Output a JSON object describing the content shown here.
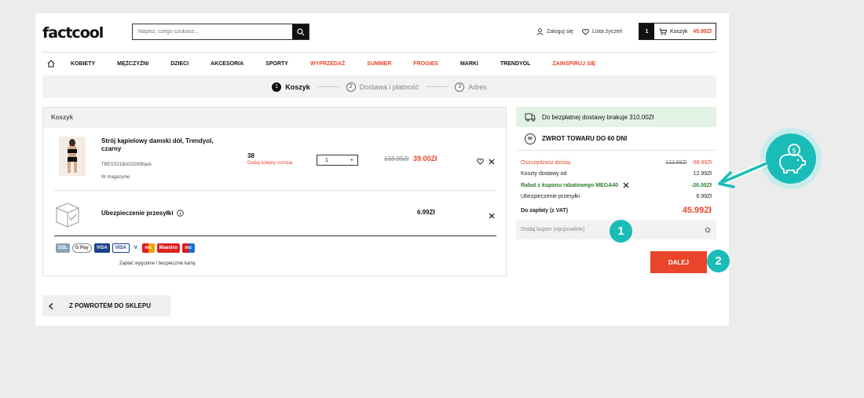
{
  "header": {
    "logo": "factcool",
    "search_placeholder": "Napisz, czego szukasz...",
    "login": "Zaloguj się",
    "wishlist": "Lista życzeń",
    "cart_count": "1",
    "cart_label": "Koszyk",
    "cart_total": "45.99Zł"
  },
  "nav": {
    "items": [
      {
        "label": "KOBIETY",
        "red": false
      },
      {
        "label": "MĘŻCZYŹNI",
        "red": false
      },
      {
        "label": "DZIECI",
        "red": false
      },
      {
        "label": "AKCESORIA",
        "red": false
      },
      {
        "label": "SPORTY",
        "red": false
      },
      {
        "label": "WYPRZEDAŻ",
        "red": true
      },
      {
        "label": "SUMMER",
        "red": true
      },
      {
        "label": "FROGIES",
        "red": true
      },
      {
        "label": "MARKI",
        "red": false
      },
      {
        "label": "TRENDYOL",
        "red": false
      },
      {
        "label": "ZAINSPIRUJ SIĘ",
        "red": true
      }
    ]
  },
  "steps": [
    {
      "num": "1",
      "label": "Koszyk"
    },
    {
      "num": "2",
      "label": "Dostawa i płatność"
    },
    {
      "num": "3",
      "label": "Adres"
    }
  ],
  "cart": {
    "title": "Koszyk",
    "product": {
      "name": "Strój kąpielowy damski dół, Trendyol, czarny",
      "sku": "TBESS21BA0228/Black",
      "stock": "W magazynie",
      "size": "38",
      "size_note": "Dodaj kolejny rozmiar",
      "qty": "1",
      "qty_plus": "+",
      "old_price": "133.99Zł",
      "new_price": "39.00Zł"
    },
    "insurance": {
      "label": "Ubezpieczenie przesyłki",
      "price": "6.99Zł"
    },
    "payment_methods": [
      "SSL",
      "G Pay",
      "VISA",
      "VISA",
      "V",
      "mc",
      "Maestro",
      "mc"
    ],
    "payment_note": "Zapłać wygodnie i bezpiecznie kartą"
  },
  "back_label": "Z POWROTEM DO SKLEPU",
  "summary": {
    "free_shipping": "Do bezpłatnej dostawy brakuje 310.00Zł",
    "return_label": "ZWROT TOWARU DO 60 DNI",
    "return_icon": "60",
    "savings_label": "Oszczędzasz dzisiaj",
    "savings_old": "133.99Zł",
    "savings_value": "-68.99Zł",
    "shipping_label": "Koszty dostawy od",
    "shipping_value": "12.99Zł",
    "coupon_label": "Rabat z kuponu rabatowego MEGA40",
    "coupon_value": "-26.00Zł",
    "insurance_label": "Ubezpieczenie przesyłki",
    "insurance_value": "6.99Zł",
    "total_label": "Do zapłaty (z VAT)",
    "total_value": "45.99Zł",
    "coupon_placeholder": "Dodaj kupon (opcjonalnie)",
    "next_label": "DALEJ"
  },
  "annotations": {
    "badge1": "1",
    "badge2": "2",
    "accent": "#1abcb8"
  }
}
